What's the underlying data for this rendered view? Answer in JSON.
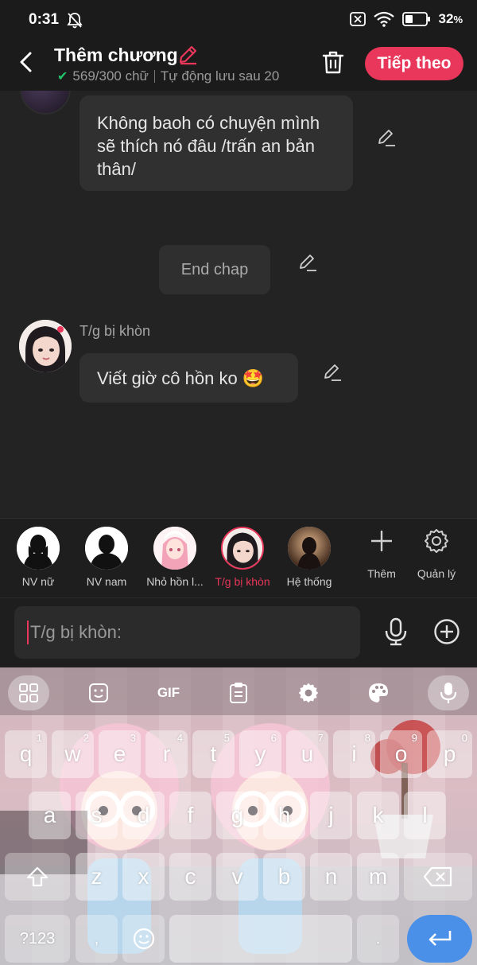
{
  "status_bar": {
    "time": "0:31",
    "battery_percent": "32",
    "battery_suffix": "%",
    "icons": [
      "bell-off-icon",
      "sim-off-icon",
      "wifi-icon",
      "battery-icon"
    ]
  },
  "header": {
    "title": "Thêm chương",
    "word_count": "569/300 chữ",
    "autosave": "Tự động lưu sau 20",
    "next_label": "Tiếp theo",
    "accent": "#e8375a"
  },
  "chat": {
    "messages": [
      {
        "text": "Không baoh có chuyện mình sẽ thích nó đâu /trấn an bản thân/"
      },
      {
        "text": "End chap"
      },
      {
        "speaker": "T/g bị khòn",
        "text": "Viết giờ cô hồn ko 🤩"
      }
    ]
  },
  "characters": [
    {
      "name": "NV nữ",
      "selected": false
    },
    {
      "name": "NV nam",
      "selected": false
    },
    {
      "name": "Nhỏ hồn l...",
      "selected": false
    },
    {
      "name": "T/g bị khòn",
      "selected": true
    },
    {
      "name": "Hệ thống",
      "selected": false
    }
  ],
  "tools": {
    "add_label": "Thêm",
    "manage_label": "Quản lý"
  },
  "input": {
    "placeholder": "T/g bị khòn:"
  },
  "keyboard": {
    "toolbar_gif": "GIF",
    "row1": [
      "q",
      "w",
      "e",
      "r",
      "t",
      "y",
      "u",
      "i",
      "o",
      "p"
    ],
    "row1_hints": [
      "1",
      "2",
      "3",
      "4",
      "5",
      "6",
      "7",
      "8",
      "9",
      "0"
    ],
    "row2": [
      "a",
      "s",
      "d",
      "f",
      "g",
      "h",
      "j",
      "k",
      "l"
    ],
    "row3": [
      "z",
      "x",
      "c",
      "v",
      "b",
      "n",
      "m"
    ],
    "symbols_label": "?123",
    "comma": ",",
    "period": ".",
    "enter_color": "#4a8fe8"
  }
}
